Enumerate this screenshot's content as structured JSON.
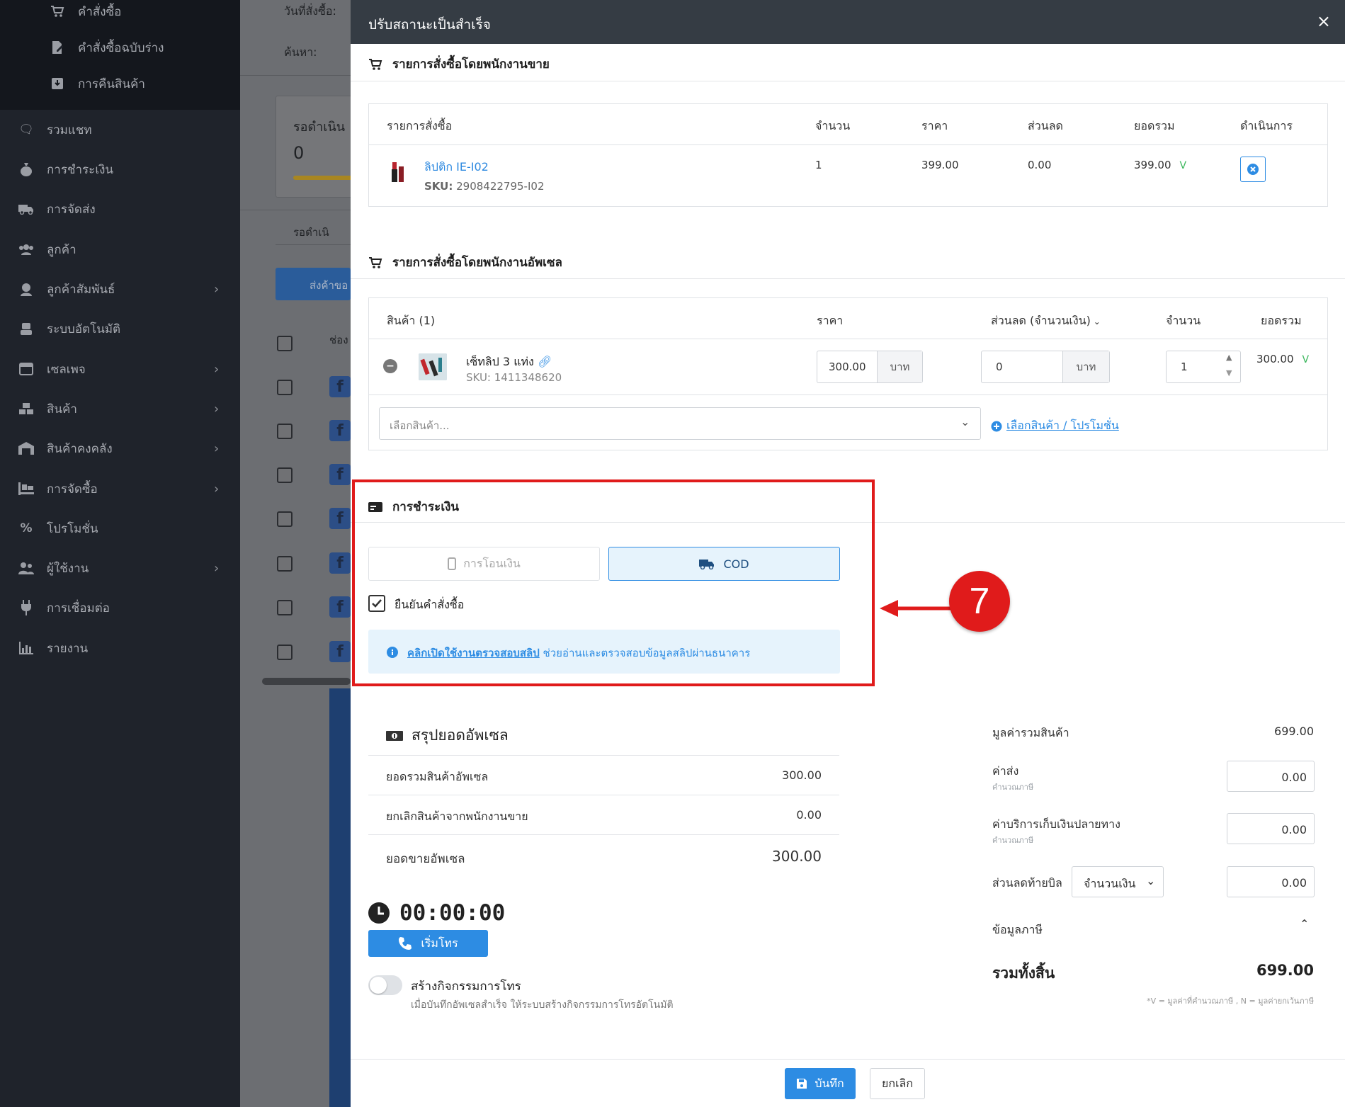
{
  "sidebar": {
    "sub_items": [
      {
        "icon": "cart-icon",
        "label": "คำสั่งซื้อ"
      },
      {
        "icon": "draft-document-icon",
        "label": "คำสั่งซื้อฉบับร่าง"
      },
      {
        "icon": "return-box-icon",
        "label": "การคืนสินค้า"
      }
    ],
    "items": [
      {
        "icon": "chat-icon",
        "label": "รวมแชท",
        "has_arrow": false
      },
      {
        "icon": "money-bag-icon",
        "label": "การชำระเงิน",
        "has_arrow": false
      },
      {
        "icon": "truck-icon",
        "label": "การจัดส่ง",
        "has_arrow": false
      },
      {
        "icon": "users-icon",
        "label": "ลูกค้า",
        "has_arrow": false
      },
      {
        "icon": "headset-icon",
        "label": "ลูกค้าสัมพันธ์",
        "has_arrow": true
      },
      {
        "icon": "robot-icon",
        "label": "ระบบอัตโนมัติ",
        "has_arrow": false
      },
      {
        "icon": "window-icon",
        "label": "เซลเพจ",
        "has_arrow": true
      },
      {
        "icon": "boxes-icon",
        "label": "สินค้า",
        "has_arrow": true
      },
      {
        "icon": "warehouse-icon",
        "label": "สินค้าคงคลัง",
        "has_arrow": true
      },
      {
        "icon": "pallet-icon",
        "label": "การจัดซื้อ",
        "has_arrow": true
      },
      {
        "icon": "percent-icon",
        "label": "โปรโมชั่น",
        "has_arrow": false
      },
      {
        "icon": "user-group-icon",
        "label": "ผู้ใช้งาน",
        "has_arrow": true
      },
      {
        "icon": "plug-icon",
        "label": "การเชื่อมต่อ",
        "has_arrow": false
      },
      {
        "icon": "chart-icon",
        "label": "รายงาน",
        "has_arrow": false
      }
    ]
  },
  "background": {
    "order_date_label": "วันที่สั่งซื้อ:",
    "search_label": "ค้นหา:",
    "card_title": "รอดำเนิน",
    "card_value": "0",
    "pending_tab": "รอดำเนิ",
    "send_button": "ส่งค้าขอ",
    "channel_header": "ช่อง"
  },
  "modal": {
    "title": "ปรับสถานะเป็นสำเร็จ",
    "close_symbol": "×",
    "sales_section": {
      "title": "รายการสั่งซื้อโดยพนักงานขาย",
      "headers": [
        "รายการสั่งซื้อ",
        "จำนวน",
        "ราคา",
        "ส่วนลด",
        "ยอดรวม",
        "ดำเนินการ"
      ],
      "row": {
        "name": "ลิปติก IE-I02",
        "sku_label": "SKU:",
        "sku": "2908422795-I02",
        "qty": "1",
        "price": "399.00",
        "discount": "0.00",
        "total": "399.00",
        "tax_mark": "V"
      }
    },
    "upsell_section": {
      "title": "รายการสั่งซื้อโดยพนักงานอัพเซล",
      "headers": {
        "product": "สินค้า (1)",
        "price": "ราคา",
        "discount": "ส่วนลด (จำนวนเงิน)",
        "qty": "จำนวน",
        "total": "ยอดรวม"
      },
      "row": {
        "name": "เซ็ทลิป 3 แท่ง",
        "sku": "SKU: 1411348620",
        "price": "300.00",
        "price_unit": "บาท",
        "discount": "0",
        "discount_unit": "บาท",
        "qty": "1",
        "total": "300.00",
        "tax_mark": "V"
      },
      "select_placeholder": "เลือกสินค้า...",
      "select_promo_link": "เลือกสินค้า / โปรโมชั่น"
    },
    "payment": {
      "title": "การชำระเงิน",
      "transfer_label": "การโอนเงิน",
      "cod_label": "COD",
      "confirm_label": "ยืนยันคำสั่งซื้อ",
      "confirm_checked": true,
      "info_link": "คลิกเปิดใช้งานตรวจสอบสลิป",
      "info_text": " ช่วยอ่านและตรวจสอบข้อมูลสลิปผ่านธนาคาร"
    },
    "callout": {
      "number": "7",
      "color": "#e01b1b"
    },
    "upsell_summary": {
      "title": "สรุปยอดอัพเซล",
      "rows": [
        {
          "label": "ยอดรวมสินค้าอัพเซล",
          "value": "300.00"
        },
        {
          "label": "ยกเลิกสินค้าจากพนักงานขาย",
          "value": "0.00"
        }
      ],
      "total_label": "ยอดขายอัพเซล",
      "total_value": "300.00"
    },
    "call": {
      "timer": "00:00:00",
      "start_button": "เริ่มโทร",
      "activity_title": "สร้างกิจกรรมการโทร",
      "activity_desc": "เมื่อบันทึกอัพเซลสำเร็จ ให้ระบบสร้างกิจกรรมการโทรอัตโนมัติ",
      "activity_enabled": false
    },
    "totals": {
      "goods_label": "มูลค่ารวมสินค้า",
      "goods_value": "699.00",
      "shipping_label": "ค่าส่ง",
      "shipping_note": "คำนวณภาษี",
      "shipping_value": "0.00",
      "cod_fee_label": "ค่าบริการเก็บเงินปลายทาง",
      "cod_fee_note": "คำนวณภาษี",
      "cod_fee_value": "0.00",
      "bill_discount_label": "ส่วนลดท้ายบิล",
      "bill_discount_type": "จำนวนเงิน",
      "bill_discount_value": "0.00",
      "tax_info_label": "ข้อมูลภาษี",
      "grand_label": "รวมทั้งสิ้น",
      "grand_value": "699.00",
      "footnote": "*V = มูลค่าที่คำนวณภาษี , N = มูลค่ายกเว้นภาษี"
    },
    "footer": {
      "save_label": "บันทึก",
      "cancel_label": "ยกเลิก"
    },
    "colors": {
      "primary": "#2d8ce3",
      "header": "#353c44",
      "highlight": "#e01b1b",
      "sidebar": "#1f232b"
    }
  }
}
